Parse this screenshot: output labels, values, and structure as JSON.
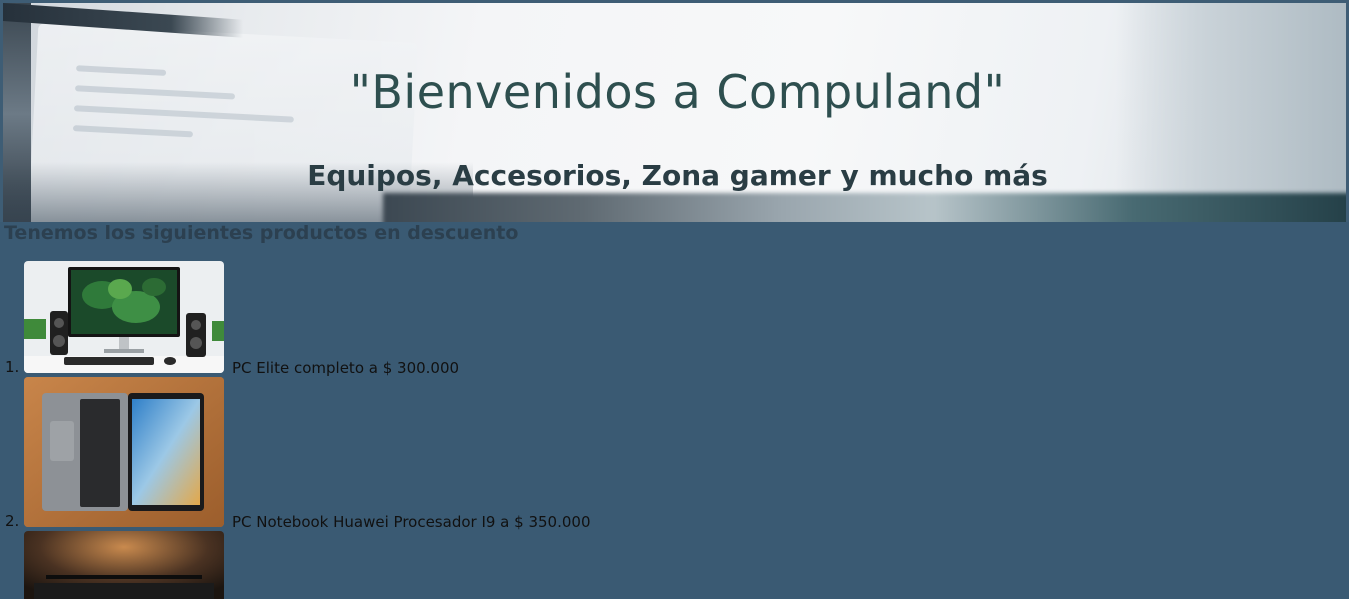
{
  "hero": {
    "title": "\"Bienvenidos a Compuland\"",
    "subtitle": "Equipos, Accesorios, Zona gamer y mucho más"
  },
  "section": {
    "heading": "Tenemos los siguientes productos en descuento"
  },
  "products": [
    {
      "number": "1.",
      "caption": "PC Elite completo a $ 300.000",
      "image": "desktop-pc-image"
    },
    {
      "number": "2.",
      "caption": "PC Notebook Huawei Procesador I9 a $ 350.000",
      "image": "notebook-image"
    },
    {
      "number": "",
      "caption": "",
      "image": "monitor-lamp-image"
    }
  ]
}
